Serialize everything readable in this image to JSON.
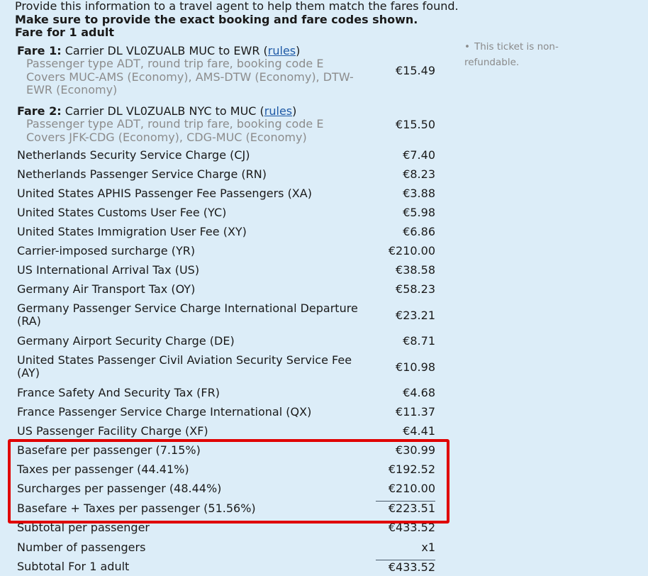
{
  "intro": {
    "line1": "Provide this information to a travel agent to help them match the fares found.",
    "line2": "Make sure to provide the exact booking and fare codes shown.",
    "line3": "Fare for 1 adult"
  },
  "side_note": {
    "bullet": "•",
    "text": "This ticket is non-refundable."
  },
  "fares": [
    {
      "title": "Fare 1:",
      "carrier": "Carrier DL VL0ZUALB MUC to EWR (",
      "rules_link": "rules",
      "close": ")",
      "passenger": "Passenger type ADT, round trip fare, booking code E",
      "covers": "Covers MUC-AMS (Economy), AMS-DTW (Economy), DTW-EWR (Economy)",
      "amount": "€15.49"
    },
    {
      "title": "Fare 2:",
      "carrier": "Carrier DL VL0ZUALB NYC to MUC (",
      "rules_link": "rules",
      "close": ")",
      "passenger": "Passenger type ADT, round trip fare, booking code E",
      "covers": "Covers JFK-CDG (Economy), CDG-MUC (Economy)",
      "amount": "€15.50"
    }
  ],
  "taxes": [
    {
      "label": "Netherlands Security Service Charge (CJ)",
      "amount": "€7.40"
    },
    {
      "label": "Netherlands Passenger Service Charge (RN)",
      "amount": "€8.23"
    },
    {
      "label": "United States APHIS Passenger Fee Passengers (XA)",
      "amount": "€3.88"
    },
    {
      "label": "United States Customs User Fee (YC)",
      "amount": "€5.98"
    },
    {
      "label": "United States Immigration User Fee (XY)",
      "amount": "€6.86"
    },
    {
      "label": "Carrier-imposed surcharge (YR)",
      "amount": "€210.00"
    },
    {
      "label": "US International Arrival Tax (US)",
      "amount": "€38.58"
    },
    {
      "label": "Germany Air Transport Tax (OY)",
      "amount": "€58.23"
    },
    {
      "label": "Germany Passenger Service Charge International Departure (RA)",
      "amount": "€23.21"
    },
    {
      "label": "Germany Airport Security Charge (DE)",
      "amount": "€8.71"
    },
    {
      "label": "United States Passenger Civil Aviation Security Service Fee (AY)",
      "amount": "€10.98"
    },
    {
      "label": "France Safety And Security Tax (FR)",
      "amount": "€4.68"
    },
    {
      "label": "France Passenger Service Charge International (QX)",
      "amount": "€11.37"
    },
    {
      "label": "US Passenger Facility Charge (XF)",
      "amount": "€4.41"
    }
  ],
  "summary": [
    {
      "label": "Basefare per passenger (7.15%)",
      "amount": "€30.99"
    },
    {
      "label": "Taxes per passenger (44.41%)",
      "amount": "€192.52"
    },
    {
      "label": "Surcharges per passenger (48.44%)",
      "amount": "€210.00"
    },
    {
      "label": "Basefare + Taxes per passenger (51.56%)",
      "amount": "€223.51"
    },
    {
      "label": "Subtotal per passenger",
      "amount": "€433.52"
    },
    {
      "label": "Number of passengers",
      "amount": "x1"
    },
    {
      "label": "Subtotal For 1 adult",
      "amount": "€433.52"
    }
  ],
  "colors": {
    "background": "#dcedf8",
    "highlight_border": "#e00000",
    "link": "#1f5aa6",
    "muted_text": "#8c8c8c"
  }
}
